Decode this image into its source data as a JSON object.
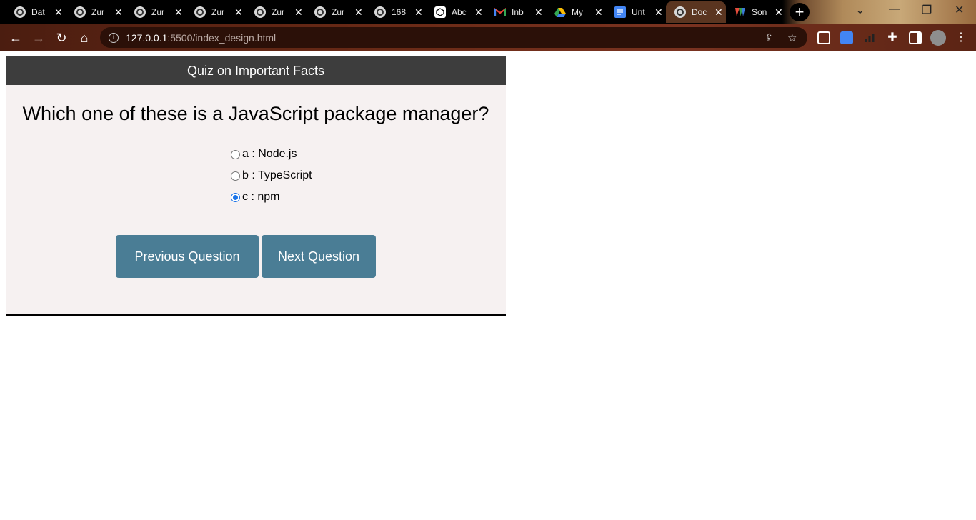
{
  "browser": {
    "tabs": [
      {
        "title": "Dat",
        "icon": "globe-icon"
      },
      {
        "title": "Zur",
        "icon": "globe-icon"
      },
      {
        "title": "Zur",
        "icon": "globe-icon"
      },
      {
        "title": "Zur",
        "icon": "globe-icon"
      },
      {
        "title": "Zur",
        "icon": "globe-icon"
      },
      {
        "title": "Zur",
        "icon": "globe-icon"
      },
      {
        "title": "168",
        "icon": "globe-icon"
      },
      {
        "title": "Abc",
        "icon": "codepen-icon"
      },
      {
        "title": "Inb",
        "icon": "gmail-icon"
      },
      {
        "title": "My",
        "icon": "drive-icon"
      },
      {
        "title": "Unt",
        "icon": "docs-icon"
      },
      {
        "title": "Doc",
        "icon": "globe-icon"
      },
      {
        "title": "Son",
        "icon": "ms-icon"
      }
    ],
    "active_tab_index": 11,
    "url_host": "127.0.0.1",
    "url_path": ":5500/index_design.html",
    "colors": {
      "tabstrip": "#000000",
      "toolbar": "#6a2a16"
    }
  },
  "quiz": {
    "header": "Quiz on Important Facts",
    "question": "Which one of these is a JavaScript package manager?",
    "answers": [
      {
        "label": "a : Node.js",
        "checked": false
      },
      {
        "label": "b : TypeScript",
        "checked": false
      },
      {
        "label": "c : npm",
        "checked": true
      }
    ],
    "prev_label": "Previous Question",
    "next_label": "Next Question",
    "colors": {
      "header_bg": "#3d3d3d",
      "panel_bg": "#f6f1f1",
      "button_bg": "#4a7d95",
      "radio_checked": "#1a73e8"
    }
  }
}
